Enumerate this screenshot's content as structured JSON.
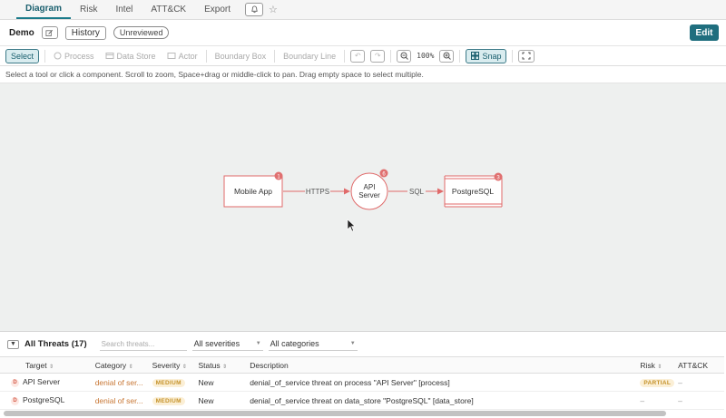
{
  "tabs": [
    {
      "label": "Diagram",
      "active": true
    },
    {
      "label": "Risk"
    },
    {
      "label": "Intel"
    },
    {
      "label": "ATT&CK"
    },
    {
      "label": "Export"
    }
  ],
  "header": {
    "title": "Demo",
    "history_label": "History",
    "status_pill": "Unreviewed",
    "edit_label": "Edit"
  },
  "toolbar": {
    "select": "Select",
    "process": "Process",
    "data_store": "Data Store",
    "actor": "Actor",
    "boundary_box": "Boundary Box",
    "boundary_line": "Boundary Line",
    "zoom_level": "100%",
    "snap": "Snap"
  },
  "hint": "Select a tool or click a component. Scroll to zoom, Space+drag or middle-click to pan. Drag empty space to select multiple.",
  "diagram": {
    "nodes": [
      {
        "label": "Mobile App",
        "badge": "1",
        "kind": "actor"
      },
      {
        "label_line1": "API",
        "label_line2": "Server",
        "badge": "6",
        "kind": "process"
      },
      {
        "label": "PostgreSQL",
        "badge": "3",
        "kind": "data_store"
      }
    ],
    "edges": [
      {
        "label": "HTTPS"
      },
      {
        "label": "SQL"
      }
    ]
  },
  "threats": {
    "title": "All Threats (17)",
    "search_placeholder": "Search threats...",
    "severity_filter": "All severities",
    "category_filter": "All categories",
    "columns": [
      "Target",
      "Category",
      "Severity",
      "Status",
      "Description",
      "Risk",
      "ATT&CK"
    ],
    "rows": [
      {
        "icon": "D",
        "target": "API Server",
        "category": "denial of ser...",
        "severity": "MEDIUM",
        "status": "New",
        "description": "denial_of_service threat on process \"API Server\" [process]",
        "risk": "PARTIAL",
        "attack": "–"
      },
      {
        "icon": "D",
        "target": "PostgreSQL",
        "category": "denial of ser...",
        "severity": "MEDIUM",
        "status": "New",
        "description": "denial_of_service threat on data_store \"PostgreSQL\" [data_store]",
        "risk": "–",
        "attack": "–"
      }
    ]
  },
  "colors": {
    "accent": "#1f6e7e",
    "node_stroke": "#e06a6a",
    "badge": "#e07070",
    "canvas_bg": "#eef0ef"
  }
}
